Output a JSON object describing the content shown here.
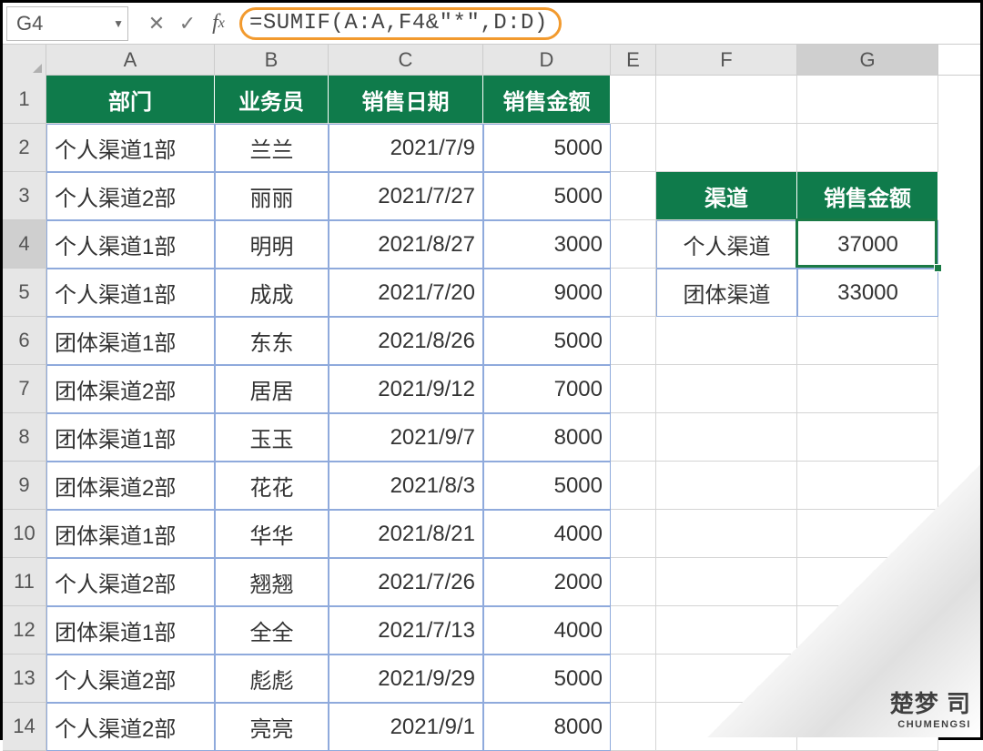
{
  "formula_bar": {
    "cell_ref": "G4",
    "formula": "=SUMIF(A:A,F4&\"*\",D:D)"
  },
  "columns": {
    "labels": [
      "A",
      "B",
      "C",
      "D",
      "E",
      "F",
      "G"
    ],
    "widths": [
      185,
      125,
      170,
      140,
      50,
      155,
      155
    ],
    "active_index": 6
  },
  "rows": {
    "labels": [
      "1",
      "2",
      "3",
      "4",
      "5",
      "6",
      "7",
      "8",
      "9",
      "10",
      "11",
      "12",
      "13",
      "14"
    ],
    "active_index": 3
  },
  "main_table": {
    "headers": [
      "部门",
      "业务员",
      "销售日期",
      "销售金额"
    ],
    "rows": [
      [
        "个人渠道1部",
        "兰兰",
        "2021/7/9",
        "5000"
      ],
      [
        "个人渠道2部",
        "丽丽",
        "2021/7/27",
        "5000"
      ],
      [
        "个人渠道1部",
        "明明",
        "2021/8/27",
        "3000"
      ],
      [
        "个人渠道1部",
        "成成",
        "2021/7/20",
        "9000"
      ],
      [
        "团体渠道1部",
        "东东",
        "2021/8/26",
        "5000"
      ],
      [
        "团体渠道2部",
        "居居",
        "2021/9/12",
        "7000"
      ],
      [
        "团体渠道1部",
        "玉玉",
        "2021/9/7",
        "8000"
      ],
      [
        "团体渠道2部",
        "花花",
        "2021/8/3",
        "5000"
      ],
      [
        "团体渠道1部",
        "华华",
        "2021/8/21",
        "4000"
      ],
      [
        "个人渠道2部",
        "翘翘",
        "2021/7/26",
        "2000"
      ],
      [
        "团体渠道1部",
        "全全",
        "2021/7/13",
        "4000"
      ],
      [
        "个人渠道2部",
        "彪彪",
        "2021/9/29",
        "5000"
      ],
      [
        "个人渠道2部",
        "亮亮",
        "2021/9/1",
        "8000"
      ]
    ]
  },
  "summary_table": {
    "headers": [
      "渠道",
      "销售金额"
    ],
    "rows": [
      [
        "个人渠道",
        "37000"
      ],
      [
        "团体渠道",
        "33000"
      ]
    ]
  },
  "active_cell": {
    "col": 6,
    "row": 3
  },
  "watermark": {
    "cn": "楚梦 司",
    "en": "CHUMENGSI"
  }
}
